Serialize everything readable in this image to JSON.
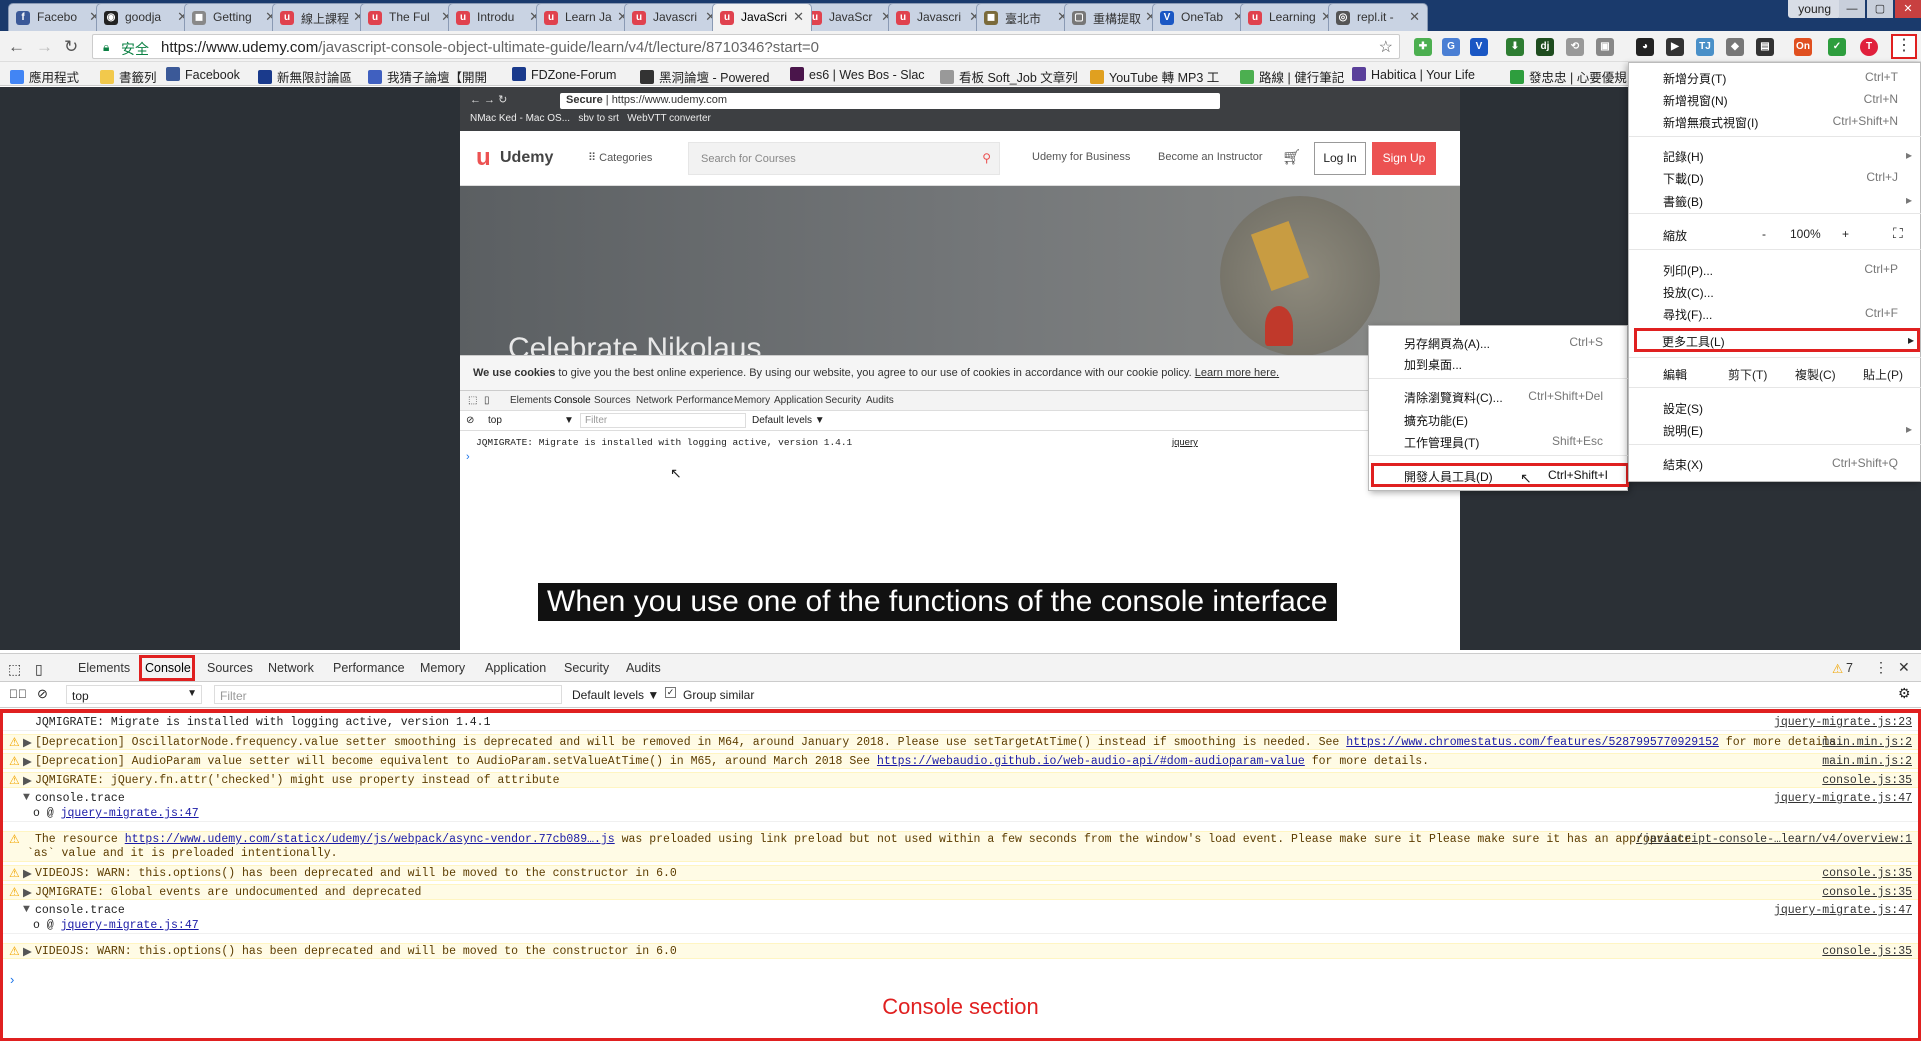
{
  "tabs": [
    {
      "label": "Facebo",
      "color": "#3b5998",
      "glyph": "f"
    },
    {
      "label": "goodja",
      "color": "#222222",
      "glyph": "◉"
    },
    {
      "label": "Getting",
      "color": "#888888",
      "glyph": "◼"
    },
    {
      "label": "線上課程",
      "color": "#e0424e",
      "glyph": "u"
    },
    {
      "label": "The Ful",
      "color": "#e0424e",
      "glyph": "u"
    },
    {
      "label": "Introdu",
      "color": "#e0424e",
      "glyph": "u"
    },
    {
      "label": "Learn Ja",
      "color": "#e0424e",
      "glyph": "u"
    },
    {
      "label": "Javascri",
      "color": "#e0424e",
      "glyph": "u"
    },
    {
      "label": "JavaScri",
      "color": "#e0424e",
      "glyph": "u",
      "active": true
    },
    {
      "label": "JavaScr",
      "color": "#e0424e",
      "glyph": "u"
    },
    {
      "label": "Javascri",
      "color": "#e0424e",
      "glyph": "u"
    },
    {
      "label": "臺北市",
      "color": "#7a6a3a",
      "glyph": "◼"
    },
    {
      "label": "重構提取",
      "color": "#777777",
      "glyph": "▢"
    },
    {
      "label": "OneTab",
      "color": "#1a57c4",
      "glyph": "V"
    },
    {
      "label": "Learning",
      "color": "#e0424e",
      "glyph": "u"
    },
    {
      "label": "repl.it -",
      "color": "#555555",
      "glyph": "◎"
    }
  ],
  "profile": "young",
  "address": {
    "secure_label": "安全",
    "url_host": "https://www.udemy.com",
    "url_path": "/javascript-console-object-ultimate-guide/learn/v4/t/lecture/8710346?start=0"
  },
  "bookmarks": [
    {
      "label": "應用程式",
      "color": "#4285f4"
    },
    {
      "label": "書籤列",
      "color": "#f2c94c"
    },
    {
      "label": "Facebook",
      "color": "#3b5998"
    },
    {
      "label": "新無限討論區",
      "color": "#1a3a8c"
    },
    {
      "label": "我猜子論壇【開開",
      "color": "#4060c0"
    },
    {
      "label": "FDZone-Forum",
      "color": "#1a3a8c"
    },
    {
      "label": "黑洞論壇 - Powered",
      "color": "#333333"
    },
    {
      "label": "es6 | Wes Bos - Slac",
      "color": "#4a154b"
    },
    {
      "label": "看板 Soft_Job 文章列",
      "color": "#999999"
    },
    {
      "label": "YouTube 轉 MP3 工",
      "color": "#e0a020"
    },
    {
      "label": "路線 | 健行筆記",
      "color": "#4caf50"
    },
    {
      "label": "Habitica | Your Life",
      "color": "#5a3f9a"
    },
    {
      "label": "發忠忠 | 心要優規",
      "color": "#2e9e3e"
    }
  ],
  "inner_browser": {
    "secure": "Secure",
    "url": "https://www.udemy.com",
    "bookmarks": [
      "NMac Ked - Mac OS...",
      "sbv to srt",
      "WebVTT converter"
    ]
  },
  "udemy": {
    "logo": "Udemy",
    "categories": "Categories",
    "search_placeholder": "Search for Courses",
    "business": "Udemy for Business",
    "instructor": "Become an Instructor",
    "login": "Log In",
    "signup": "Sign Up",
    "hero_text": "Celebrate Nikolaus"
  },
  "cookie": {
    "bold": "We use cookies",
    "text": " to give you the best online experience. By using our website, you agree to our use of cookies in accordance with our cookie policy. ",
    "link": "Learn more here."
  },
  "inner_devtools": {
    "tabs": [
      "Elements",
      "Console",
      "Sources",
      "Network",
      "Performance",
      "Memory",
      "Application",
      "Security",
      "Audits"
    ],
    "context": "top",
    "filter": "Filter",
    "levels": "Default levels",
    "log": "JQMIGRATE: Migrate is installed with logging active, version 1.4.1",
    "src": "jquery"
  },
  "subtitle": "When you use one of the functions of the console interface",
  "submenu": [
    {
      "label": "另存網頁為(A)...",
      "key": "Ctrl+S"
    },
    {
      "label": "加到桌面...",
      "key": ""
    },
    {
      "label": "清除瀏覽資料(C)...",
      "key": "Ctrl+Shift+Del"
    },
    {
      "label": "擴充功能(E)",
      "key": ""
    },
    {
      "label": "工作管理員(T)",
      "key": "Shift+Esc"
    },
    {
      "label": "開發人員工具(D)",
      "key": "Ctrl+Shift+I"
    }
  ],
  "mainmenu": {
    "new_tab": {
      "label": "新增分頁(T)",
      "key": "Ctrl+T"
    },
    "new_window": {
      "label": "新增視窗(N)",
      "key": "Ctrl+N"
    },
    "incognito": {
      "label": "新增無痕式視窗(I)",
      "key": "Ctrl+Shift+N"
    },
    "history": {
      "label": "記錄(H)"
    },
    "downloads": {
      "label": "下載(D)",
      "key": "Ctrl+J"
    },
    "bookmarks": {
      "label": "書籤(B)"
    },
    "zoom": {
      "label": "縮放",
      "minus": "-",
      "value": "100%",
      "plus": "+"
    },
    "print": {
      "label": "列印(P)...",
      "key": "Ctrl+P"
    },
    "cast": {
      "label": "投放(C)..."
    },
    "find": {
      "label": "尋找(F)...",
      "key": "Ctrl+F"
    },
    "more_tools": {
      "label": "更多工具(L)"
    },
    "edit": {
      "label": "編輯",
      "cut": "剪下(T)",
      "copy": "複製(C)",
      "paste": "貼上(P)"
    },
    "settings": {
      "label": "設定(S)"
    },
    "help": {
      "label": "說明(E)"
    },
    "exit": {
      "label": "結束(X)",
      "key": "Ctrl+Shift+Q"
    }
  },
  "devtools": {
    "tabs": [
      "Elements",
      "Console",
      "Sources",
      "Network",
      "Performance",
      "Memory",
      "Application",
      "Security",
      "Audits"
    ],
    "warning_count": "7",
    "context": "top",
    "filter_placeholder": "Filter",
    "levels": "Default levels",
    "group_similar": "Group similar",
    "logs": [
      {
        "type": "info",
        "arrow": "",
        "text": "JQMIGRATE: Migrate is installed with logging active, version 1.4.1",
        "src": "jquery-migrate.js:23"
      },
      {
        "type": "warn",
        "arrow": "▶",
        "pre": "[Deprecation] OscillatorNode.frequency.value setter smoothing is deprecated and will be removed in M64, around January 2018. Please use setTargetAtTime() instead if smoothing is needed. See ",
        "link": "https://www.chromestatus.com/features/5287995770929152",
        "post": " for more details.",
        "src": "main.min.js:2"
      },
      {
        "type": "warn",
        "arrow": "▶",
        "pre": "[Deprecation] AudioParam value setter will become equivalent to AudioParam.setValueAtTime() in M65, around March 2018  See ",
        "link": "https://webaudio.github.io/web-audio-api/#dom-audioparam-value",
        "post": " for more details.",
        "src": "main.min.js:2"
      },
      {
        "type": "warn",
        "arrow": "▶",
        "text": "JQMIGRATE: jQuery.fn.attr('checked') might use property instead of attribute",
        "src": "console.js:35"
      },
      {
        "type": "info",
        "arrow": "▼",
        "text": "console.trace",
        "src": "jquery-migrate.js:47",
        "sub": "jquery-migrate.js:47"
      },
      {
        "type": "warn",
        "arrow": "",
        "pre": "The resource ",
        "link": "https://www.udemy.com/staticx/udemy/js/webpack/async-vendor.77cb089….js",
        "post": " was preloaded using link preload but not used within a few seconds from the window's load event. Please make sure it Please make sure it has an appropriate",
        "line2": "`as` value and it is preloaded intentionally.",
        "src": "/javascript-console-…learn/v4/overview:1"
      },
      {
        "type": "warn",
        "arrow": "▶",
        "text": "VIDEOJS: WARN: this.options() has been deprecated and will be moved to the constructor in 6.0",
        "src": "console.js:35"
      },
      {
        "type": "warn",
        "arrow": "▶",
        "text": "JQMIGRATE: Global events are undocumented and deprecated",
        "src": "console.js:35"
      },
      {
        "type": "info",
        "arrow": "▼",
        "text": "console.trace",
        "src": "jquery-migrate.js:47",
        "sub": "jquery-migrate.js:47"
      },
      {
        "type": "warn",
        "arrow": "▶",
        "text": "VIDEOJS: WARN: this.options() has been deprecated and will be moved to the constructor in 6.0",
        "src": "console.js:35"
      }
    ],
    "annotation": "Console section"
  }
}
